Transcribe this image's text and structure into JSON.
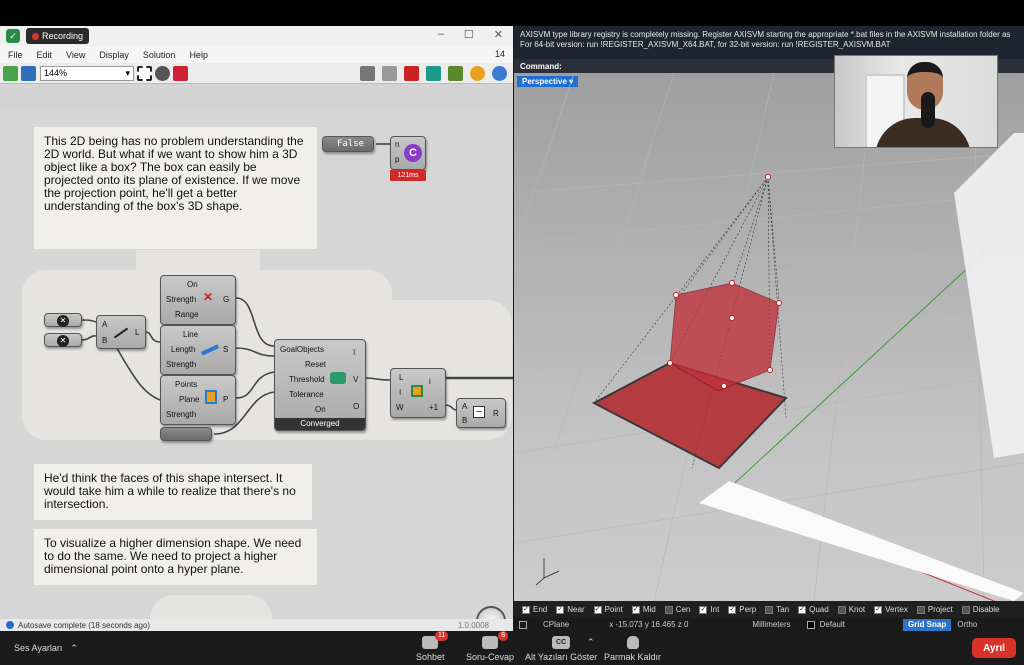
{
  "recording": {
    "label": "Recording"
  },
  "grasshopper": {
    "window_number": "14",
    "menu": [
      "File",
      "Edit",
      "View",
      "Display",
      "Solution",
      "Help"
    ],
    "zoom": "144%",
    "notes": [
      "This 2D being has no problem understanding the 2D world. But what if we want to show him a 3D object like a box? The box can easily be projected onto its plane of existence. If we move the projection point, he'll get a better understanding of the box's 3D shape.",
      "He'd think the faces of this shape intersect. It would take him a while to realize that there's no intersection.",
      "To visualize a higher dimension shape. We need to do the same. We need to project a higher dimensional point onto a hyper plane."
    ],
    "toggle_value": "False",
    "timer": "121ms",
    "line_comp": {
      "in": [
        "A",
        "B"
      ],
      "out": "L"
    },
    "on_group": {
      "rows": [
        "On",
        "Strength",
        "Range"
      ],
      "out": "G"
    },
    "length_group": {
      "rows": [
        "Line",
        "Length",
        "Strength"
      ],
      "out": "S"
    },
    "plane_group": {
      "rows": [
        "Points",
        "Plane",
        "Strength"
      ],
      "out": "P"
    },
    "solver": {
      "rows": [
        "GoalObjects",
        "Reset",
        "Threshold",
        "Tolerance",
        "On"
      ],
      "outs": [
        "I",
        "V",
        "O"
      ],
      "status": "Converged"
    },
    "series": {
      "in": [
        "L",
        "I",
        "W"
      ],
      "out": "i",
      "extra": "+1"
    },
    "subtract": {
      "in": [
        "A",
        "B"
      ],
      "out": "R"
    },
    "concat": {
      "in": [
        "n",
        "p"
      ]
    },
    "status": "Autosave complete (18 seconds ago)",
    "version": "1.0.0008"
  },
  "rhino": {
    "message": "AXISVM type library registry is completely missing. Register AXISVM starting the appropriate *.bat files in the AXISVM installation folder as For 64-bit version: run !REGISTER_AXISVM_X64.BAT, for 32-bit version: run !REGISTER_AXISVM.BAT",
    "command_label": "Command:",
    "viewport": "Perspective",
    "snaps": [
      {
        "label": "End",
        "on": true
      },
      {
        "label": "Near",
        "on": true
      },
      {
        "label": "Point",
        "on": true
      },
      {
        "label": "Mid",
        "on": true
      },
      {
        "label": "Cen",
        "on": false
      },
      {
        "label": "Int",
        "on": true
      },
      {
        "label": "Perp",
        "on": true
      },
      {
        "label": "Tan",
        "on": false
      },
      {
        "label": "Quad",
        "on": true
      },
      {
        "label": "Knot",
        "on": false
      },
      {
        "label": "Vertex",
        "on": true
      },
      {
        "label": "Project",
        "on": false
      },
      {
        "label": "Disable",
        "on": false
      }
    ],
    "cplane": "CPlane",
    "coords": "x -15.073   y 16.465   z 0",
    "units": "Millimeters",
    "layer": "Default",
    "grid_snap": "Grid Snap",
    "ortho": "Ortho"
  },
  "zoom_bar": {
    "audio_settings": "Ses Ayarları",
    "chat": {
      "label": "Sohbet",
      "count": "11"
    },
    "qa": {
      "label": "Soru-Cevap",
      "count": "8"
    },
    "captions": "Alt Yazıları Göster",
    "raise_hand": "Parmak Kaldır",
    "leave": "Ayrıl"
  },
  "colors": {
    "accent": "#1f6fd0",
    "leave": "#d9322b",
    "box": "#b3262b"
  }
}
